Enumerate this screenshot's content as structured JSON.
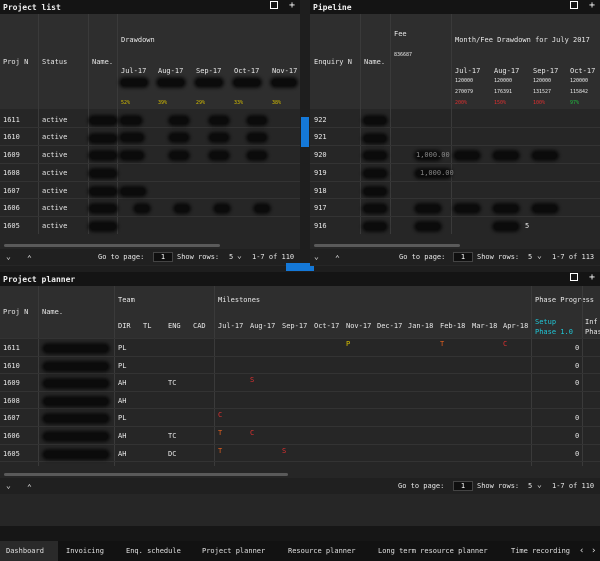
{
  "project_list": {
    "title": "Project list",
    "headers": {
      "proj_no": "Proj N",
      "status": "Status",
      "name": "Name.",
      "drawdown": "Drawdown"
    },
    "months": [
      "Jul-17",
      "Aug-17",
      "Sep-17",
      "Oct-17",
      "Nov-17"
    ],
    "percents": [
      "52%",
      "39%",
      "29%",
      "33%",
      "38%"
    ],
    "rows": [
      {
        "no": "1611",
        "status": "active"
      },
      {
        "no": "1610",
        "status": "active"
      },
      {
        "no": "1609",
        "status": "active"
      },
      {
        "no": "1608",
        "status": "active"
      },
      {
        "no": "1607",
        "status": "active"
      },
      {
        "no": "1606",
        "status": "active"
      },
      {
        "no": "1605",
        "status": "active"
      }
    ],
    "footer": {
      "go_to_page": "Go to page:",
      "page": "1",
      "show_rows": "Show rows:",
      "rows_value": "5",
      "range": "1-7 of 110"
    }
  },
  "pipeline": {
    "title": "Pipeline",
    "headers": {
      "enquiry": "Enquiry N",
      "name": "Name.",
      "fee": "Fee",
      "fee_value": "836687",
      "month_fee": "Month/Fee Drawdown for July 2017"
    },
    "months": [
      "Jul-17",
      "Aug-17",
      "Sep-17",
      "Oct-17"
    ],
    "row1": [
      "120000",
      "120000",
      "120000",
      "120000"
    ],
    "row2": [
      "270079",
      "176391",
      "131527",
      "115842"
    ],
    "percents": [
      "200%",
      "150%",
      "100%",
      "97%"
    ],
    "rows": [
      "922",
      "921",
      "920",
      "919",
      "918",
      "917",
      "916"
    ],
    "fragments": [
      "1,000.00",
      "1,000.00",
      "5"
    ],
    "footer": {
      "go_to_page": "Go to page:",
      "page": "1",
      "show_rows": "Show rows:",
      "rows_value": "5",
      "range": "1-7 of 113"
    }
  },
  "planner": {
    "title": "Project planner",
    "headers": {
      "proj_no": "Proj N",
      "name": "Name.",
      "team": "Team",
      "milestones": "Milestones",
      "phase_progress": "Phase Progress"
    },
    "team_cols": [
      "DIR",
      "TL",
      "ENG",
      "CAD"
    ],
    "months": [
      "Jul-17",
      "Aug-17",
      "Sep-17",
      "Oct-17",
      "Nov-17",
      "Dec-17",
      "Jan-18",
      "Feb-18",
      "Mar-18",
      "Apr-18"
    ],
    "phase": [
      "Setup",
      "Phase 1.0"
    ],
    "phase_next": [
      "Inf",
      "Phas"
    ],
    "rows": [
      {
        "no": "1611",
        "dir": "PL",
        "eng": "",
        "prog": "0"
      },
      {
        "no": "1610",
        "dir": "PL",
        "eng": "",
        "prog": "0"
      },
      {
        "no": "1609",
        "dir": "AH",
        "eng": "TC",
        "prog": "0"
      },
      {
        "no": "1608",
        "dir": "AH",
        "eng": "",
        "prog": ""
      },
      {
        "no": "1607",
        "dir": "PL",
        "eng": "",
        "prog": "0"
      },
      {
        "no": "1606",
        "dir": "AH",
        "eng": "TC",
        "prog": "0"
      },
      {
        "no": "1605",
        "dir": "AH",
        "eng": "DC",
        "prog": "0"
      }
    ],
    "markers": {
      "p": "P",
      "t": "T",
      "c": "C",
      "s": "S"
    },
    "footer": {
      "go_to_page": "Go to page:",
      "page": "1",
      "show_rows": "Show rows:",
      "rows_value": "5",
      "range": "1-7 of 110"
    }
  },
  "tabs": [
    "Dashboard",
    "Invoicing",
    "Enq. schedule",
    "Project planner",
    "Resource planner",
    "Long term resource planner",
    "Time recording"
  ],
  "nav": {
    "prev": "‹",
    "next": "›"
  },
  "ctrl": {
    "plus": "+",
    "down": "⌄",
    "up": "⌃"
  }
}
